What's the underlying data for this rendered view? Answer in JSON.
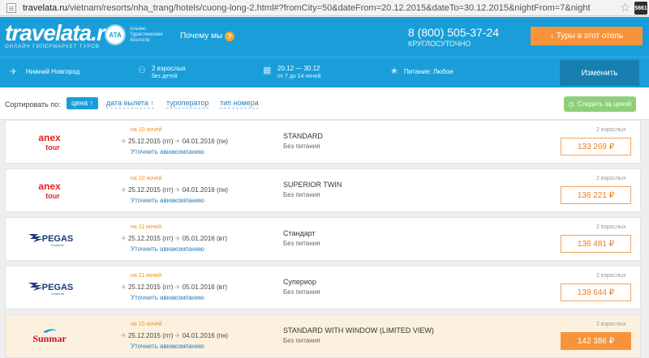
{
  "browser": {
    "url_prefix": "travelata.ru",
    "url_rest": "/vietnam/resorts/nha_trang/hotels/cuong-long-2.html#?fromCity=50&dateFrom=20.12.2015&dateTo=30.12.2015&nightFrom=7&nightTo=14&pric",
    "extension_badge": "5861"
  },
  "header": {
    "logo": "travelata.ru",
    "tagline": "ОНЛАЙН ГИПЕРМАРКЕТ ТУРОВ",
    "ata_badge": "АТА",
    "ata_text": "Альянс Туристических Агентств",
    "why_link": "Почему мы",
    "why_q": "?",
    "phone": "8 (800) 505-37-24",
    "phone_sub": "КРУГЛОСУТОЧНО",
    "tours_button": "↓ Туры в этот отель"
  },
  "search": {
    "city": "Нижний Новгород",
    "travelers": "2 взрослых",
    "travelers_sub": "без детей",
    "dates": "20.12 — 30.12",
    "dates_sub": "от 7 до 14 ночей",
    "meal": "Питание: Любое",
    "change_button": "Изменить"
  },
  "sort": {
    "label": "Сортировать по:",
    "active": "цена ↑",
    "options": [
      "дата вылета ↑",
      "туроператор",
      "тип номера"
    ],
    "track_button": "Следить за ценой"
  },
  "offers": [
    {
      "operator": "anex tour",
      "nights": "на 10 ночей",
      "date_from": "25.12.2015 (пт)",
      "date_to": "04.01.2016 (пн)",
      "airline": "Уточнить авиакомпанию",
      "room": "STANDARD",
      "meal": "Без питания",
      "adults": "2 взрослых",
      "price": "133 269 ₽",
      "logo_color": "#e2231a"
    },
    {
      "operator": "anex tour",
      "nights": "на 10 ночей",
      "date_from": "25.12.2015 (пт)",
      "date_to": "04.01.2016 (пн)",
      "airline": "Уточнить авиакомпанию",
      "room": "SUPERIOR TWIN",
      "meal": "Без питания",
      "adults": "2 взрослых",
      "price": "136 221 ₽",
      "logo_color": "#e2231a"
    },
    {
      "operator": "PEGAS",
      "nights": "на 11 ночей",
      "date_from": "25.12.2015 (пт)",
      "date_to": "05.01.2016 (вт)",
      "airline": "Уточнить авиакомпанию",
      "room": "Стандарт",
      "meal": "Без питания",
      "adults": "2 взрослых",
      "price": "136 481 ₽",
      "logo_color": "#1d3a7a"
    },
    {
      "operator": "PEGAS",
      "nights": "на 11 ночей",
      "date_from": "25.12.2015 (пт)",
      "date_to": "05.01.2016 (вт)",
      "airline": "Уточнить авиакомпанию",
      "room": "Супериор",
      "meal": "Без питания",
      "adults": "2 взрослых",
      "price": "139 644 ₽",
      "logo_color": "#1d3a7a"
    },
    {
      "operator": "Sunmar",
      "nights": "на 10 ночей",
      "date_from": "25.12.2015 (пт)",
      "date_to": "04.01.2016 (пн)",
      "airline": "Уточнить авиакомпанию",
      "room": "STANDARD WITH WINDOW (LIMITED VIEW)",
      "meal": "Без питания",
      "adults": "2 взрослых",
      "price": "142 386 ₽",
      "logo_color": "#c8102e"
    }
  ]
}
